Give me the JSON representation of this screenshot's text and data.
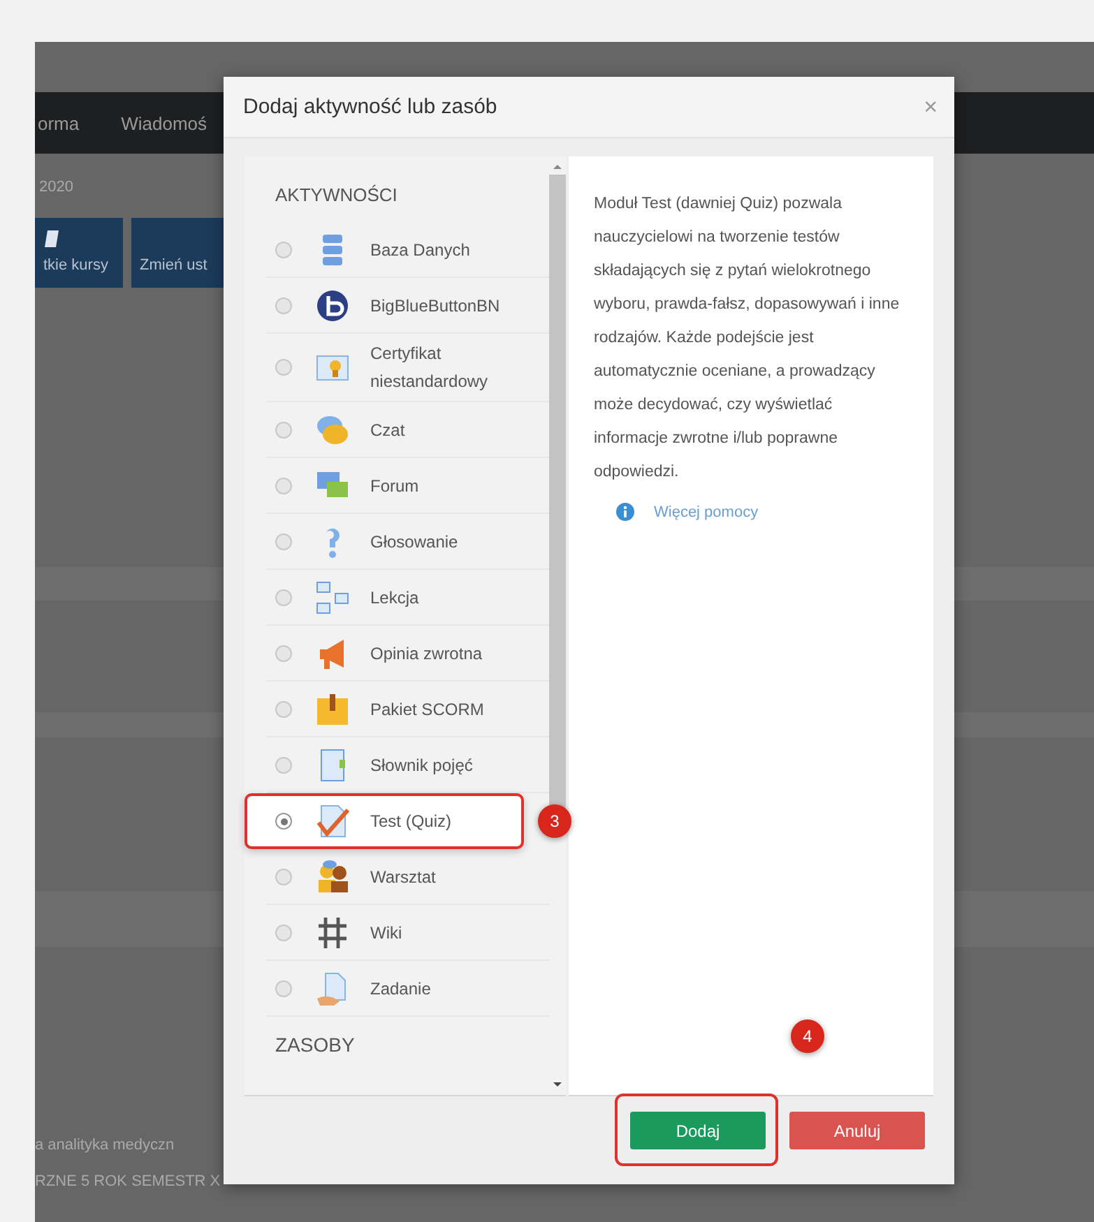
{
  "background_page": {
    "nav_items": [
      "orma",
      "Wiadomoś"
    ],
    "date": "2020",
    "buttons": [
      "tkie kursy",
      "Zmień ust"
    ],
    "course_lines": [
      "a analityka medyczn",
      "RZNE 5 ROK SEMESTR X"
    ]
  },
  "dialog": {
    "title": "Dodaj aktywność lub zasób",
    "close": "×",
    "activities_heading": "AKTYWNOŚCI",
    "items": [
      {
        "label": "Baza Danych",
        "selected": false
      },
      {
        "label": "BigBlueButtonBN",
        "selected": false
      },
      {
        "label": "Certyfikat niestandardowy",
        "selected": false
      },
      {
        "label": "Czat",
        "selected": false
      },
      {
        "label": "Forum",
        "selected": false
      },
      {
        "label": "Głosowanie",
        "selected": false
      },
      {
        "label": "Lekcja",
        "selected": false
      },
      {
        "label": "Opinia zwrotna",
        "selected": false
      },
      {
        "label": "Pakiet SCORM",
        "selected": false
      },
      {
        "label": "Słownik pojęć",
        "selected": false
      },
      {
        "label": "Test (Quiz)",
        "selected": true,
        "callout": "3"
      },
      {
        "label": "Warsztat",
        "selected": false
      },
      {
        "label": "Wiki",
        "selected": false
      },
      {
        "label": "Zadanie",
        "selected": false
      }
    ],
    "resources_heading": "ZASOBY",
    "description": "Moduł Test (dawniej Quiz) pozwala nauczycielowi na tworzenie testów składających się z pytań wielokrotnego wyboru, prawda-fałsz, dopasowywań i inne rodzajów. Każde podejście jest automatycznie oceniane, a prowadzący może decydować, czy wyświetlać informacje zwrotne i/lub poprawne odpowiedzi.",
    "help_link": "Więcej pomocy",
    "buttons": [
      {
        "label": "Dodaj",
        "kind": "primary",
        "callout": "4"
      },
      {
        "label": "Anuluj",
        "kind": "danger"
      }
    ]
  }
}
